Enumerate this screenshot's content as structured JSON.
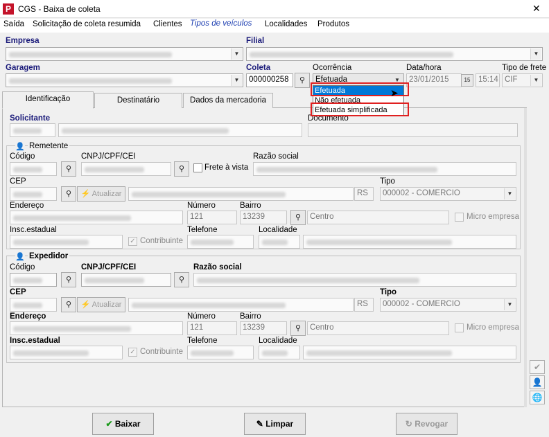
{
  "window": {
    "title": "CGS - Baixa de coleta",
    "app_icon": "P",
    "close": "✕"
  },
  "menu": [
    "Saída",
    "Solicitação de coleta resumida",
    "Clientes",
    "Tipos de veículos",
    "Localidades",
    "Produtos"
  ],
  "header": {
    "empresa_label": "Empresa",
    "filial_label": "Filial",
    "garagem_label": "Garagem",
    "coleta_label": "Coleta",
    "coleta_value": "000000258",
    "ocorrencia_label": "Ocorrência",
    "ocorrencia_value": "Efetuada",
    "datahora_label": "Data/hora",
    "date_value": "23/01/2015",
    "cal_btn": "15",
    "time_value": "15:14",
    "tipo_frete_label": "Tipo de frete",
    "tipo_frete_value": "CIF"
  },
  "dropdown_options": [
    "Efetuada",
    "Não efetuada",
    "Efetuada simplificada"
  ],
  "tabs": [
    "Identificação",
    "Destinatário",
    "Dados da mercadoria"
  ],
  "solicitante": {
    "label": "Solicitante",
    "documento_label": "Documento"
  },
  "remetente": {
    "group": "Remetente",
    "codigo": "Código",
    "cnpj": "CNPJ/CPF/CEI",
    "frete_vista": "Frete à vista",
    "razao": "Razão social",
    "cep": "CEP",
    "atualizar": "Atualizar",
    "uf": "RS",
    "tipo_label": "Tipo",
    "tipo_value": "000002 - COMERCIO",
    "endereco": "Endereço",
    "numero_label": "Número",
    "numero": "121",
    "bairro_label": "Bairro",
    "bairro_code": "13239",
    "bairro_name": "Centro",
    "micro": "Micro empresa",
    "insc": "Insc.estadual",
    "contribuinte": "Contribuinte",
    "telefone": "Telefone",
    "localidade": "Localidade"
  },
  "expedidor": {
    "group": "Expedidor",
    "codigo": "Código",
    "cnpj": "CNPJ/CPF/CEI",
    "razao": "Razão social",
    "cep": "CEP",
    "atualizar": "Atualizar",
    "uf": "RS",
    "tipo_label": "Tipo",
    "tipo_value": "000002 - COMERCIO",
    "endereco": "Endereço",
    "numero_label": "Número",
    "numero": "121",
    "bairro_label": "Bairro",
    "bairro_code": "13239",
    "bairro_name": "Centro",
    "micro": "Micro empresa",
    "insc": "Insc.estadual",
    "contribuinte": "Contribuinte",
    "telefone": "Telefone",
    "localidade": "Localidade"
  },
  "buttons": {
    "baixar": "Baixar",
    "limpar": "Limpar",
    "revogar": "Revogar"
  },
  "colors": {
    "highlight": "#0078d7",
    "red_box": "#e02020",
    "bold_label": "#1a1a7a",
    "menu_link": "#1a3cb0"
  }
}
